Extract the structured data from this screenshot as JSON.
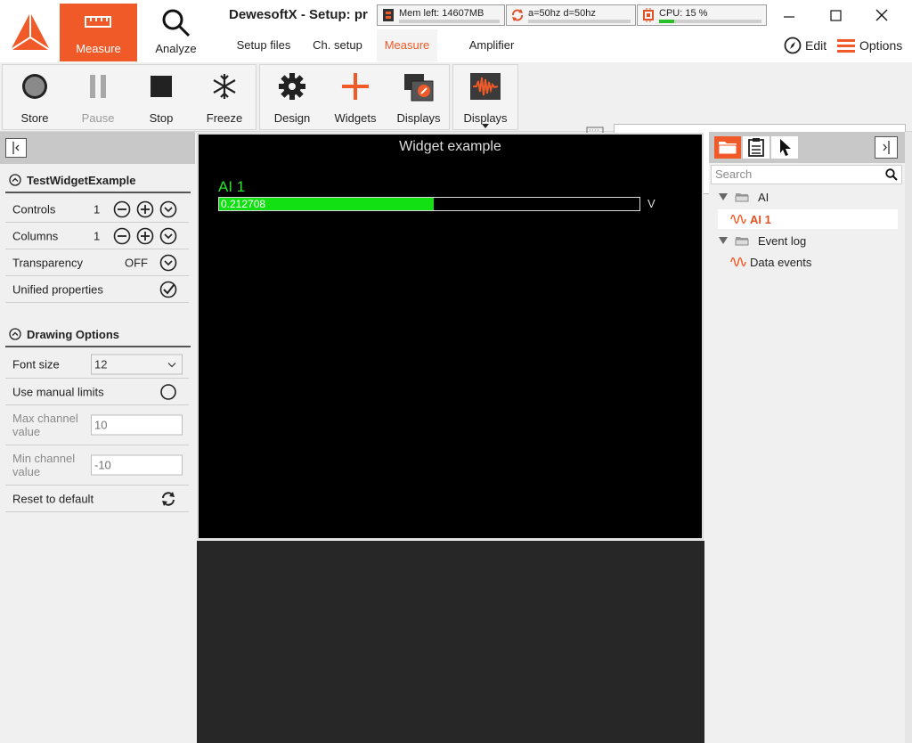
{
  "app": {
    "title": "DewesoftX - Setup: pr",
    "modes": [
      {
        "label": "Measure",
        "active": true
      },
      {
        "label": "Analyze",
        "active": false
      }
    ],
    "tabs": [
      {
        "label": "Setup files"
      },
      {
        "label": "Ch. setup"
      },
      {
        "label": "Measure",
        "active": true
      },
      {
        "label": "Amplifier"
      }
    ],
    "status": {
      "mem": "Mem left: 14607MB",
      "rate": "a=50hz d=50hz",
      "cpu": "CPU: 15 %",
      "cpu_fraction": 0.15
    },
    "edit_label": "Edit",
    "options_label": "Options",
    "accent": "#f05a28"
  },
  "toolbar": {
    "store": "Store",
    "pause": "Pause",
    "stop": "Stop",
    "freeze": "Freeze",
    "design": "Design",
    "widgets": "Widgets",
    "displays_btn": "Displays",
    "displays_menu": "Displays"
  },
  "left": {
    "section1": "TestWidgetExample",
    "controls": {
      "label": "Controls",
      "value": "1"
    },
    "columns": {
      "label": "Columns",
      "value": "1"
    },
    "transparency": {
      "label": "Transparency",
      "value": "OFF"
    },
    "unified": {
      "label": "Unified properties"
    },
    "section2": "Drawing Options",
    "font_size": {
      "label": "Font size",
      "value": "12"
    },
    "manual_limits": {
      "label": "Use manual limits"
    },
    "max_value": {
      "label_1": "Max channel",
      "label_2": "value",
      "placeholder": "10"
    },
    "min_value": {
      "label_1": "Min channel",
      "label_2": "value",
      "placeholder": "-10"
    },
    "reset": {
      "label": "Reset to default"
    }
  },
  "widget": {
    "title": "Widget example",
    "channel": "AI 1",
    "value": "0.212708",
    "unit": "V",
    "min": -10,
    "max": 10,
    "reading": 0.212708,
    "bar_color": "#12e012"
  },
  "right": {
    "search_placeholder": "Search",
    "tree": [
      {
        "label": "AI",
        "type": "group"
      },
      {
        "label": "AI 1",
        "type": "channel",
        "selected": true
      },
      {
        "label": "Event log",
        "type": "group"
      },
      {
        "label": "Data events",
        "type": "channel"
      }
    ]
  }
}
